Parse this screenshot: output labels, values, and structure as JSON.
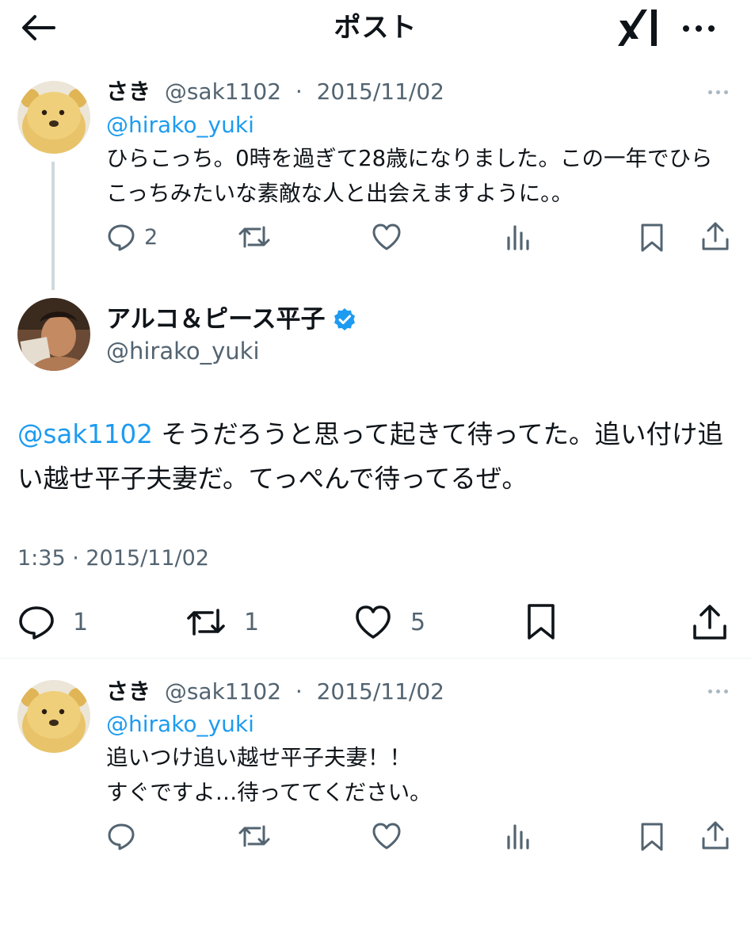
{
  "header": {
    "title": "ポスト",
    "back_icon": "arrow-left-icon",
    "logo_icon": "grok-icon",
    "more_icon": "more-icon"
  },
  "posts": [
    {
      "name": "さき",
      "handle": "@sak1102",
      "separator": "·",
      "date": "2015/11/02",
      "mention": "@hirako_yuki",
      "text": "ひらこっち。0時を過ぎて28歳になりました。この一年でひらこっちみたいな素敵な人と出会えますように。。",
      "replies": "2",
      "avatar": "winnie-the-pooh-avatar"
    },
    {
      "name": "さき",
      "handle": "@sak1102",
      "separator": "·",
      "date": "2015/11/02",
      "mention": "@hirako_yuki",
      "text_lines": [
        "追いつけ追い越せ平子夫妻！！",
        "すぐですよ…待っててください。"
      ],
      "replies": "",
      "avatar": "winnie-the-pooh-avatar"
    }
  ],
  "main_post": {
    "name": "アルコ＆ピース平子",
    "handle": "@hirako_yuki",
    "verified": true,
    "mention": "@sak1102",
    "text": " そうだろうと思って起きて待ってた。追い付け追い越せ平子夫妻だ。てっぺんで待ってるぜ。",
    "time": "1:35 · 2015/11/02",
    "replies": "1",
    "reposts": "1",
    "likes": "5"
  },
  "colors": {
    "accent": "#1d9bf0",
    "text": "#0f1419",
    "muted": "#536471",
    "border": "#eff3f4"
  }
}
